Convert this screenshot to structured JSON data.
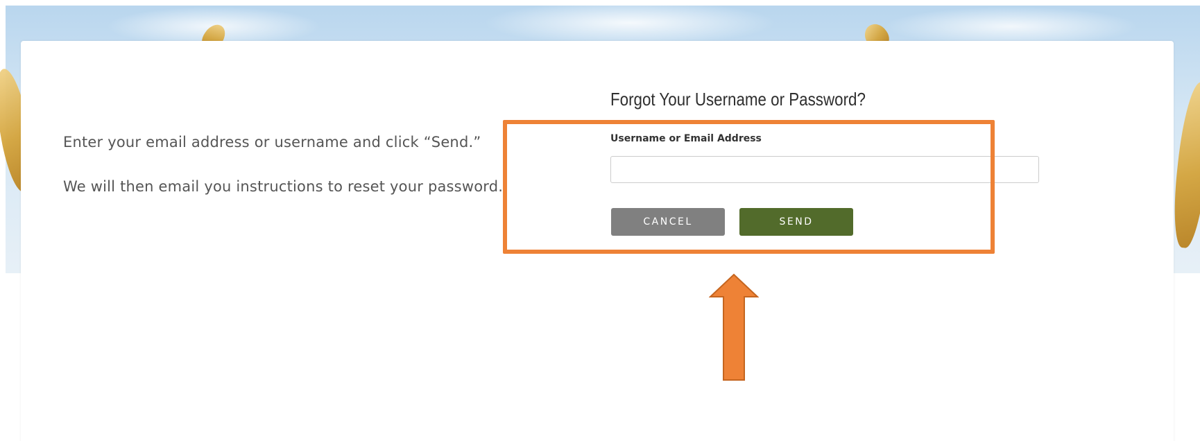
{
  "intro": {
    "line1": "Enter your email address or username and click “Send.”",
    "line2": "We will then email you instructions to reset your password."
  },
  "form": {
    "title": "Forgot Your Username or Password?",
    "field_label": "Username or Email Address",
    "field_value": "",
    "field_placeholder": "",
    "cancel_label": "CANCEL",
    "send_label": "SEND"
  },
  "colors": {
    "highlight": "#ee8236",
    "send_button": "#526b2b",
    "cancel_button": "#808080"
  },
  "icons": {
    "annotation_arrow": "up-arrow-icon"
  }
}
